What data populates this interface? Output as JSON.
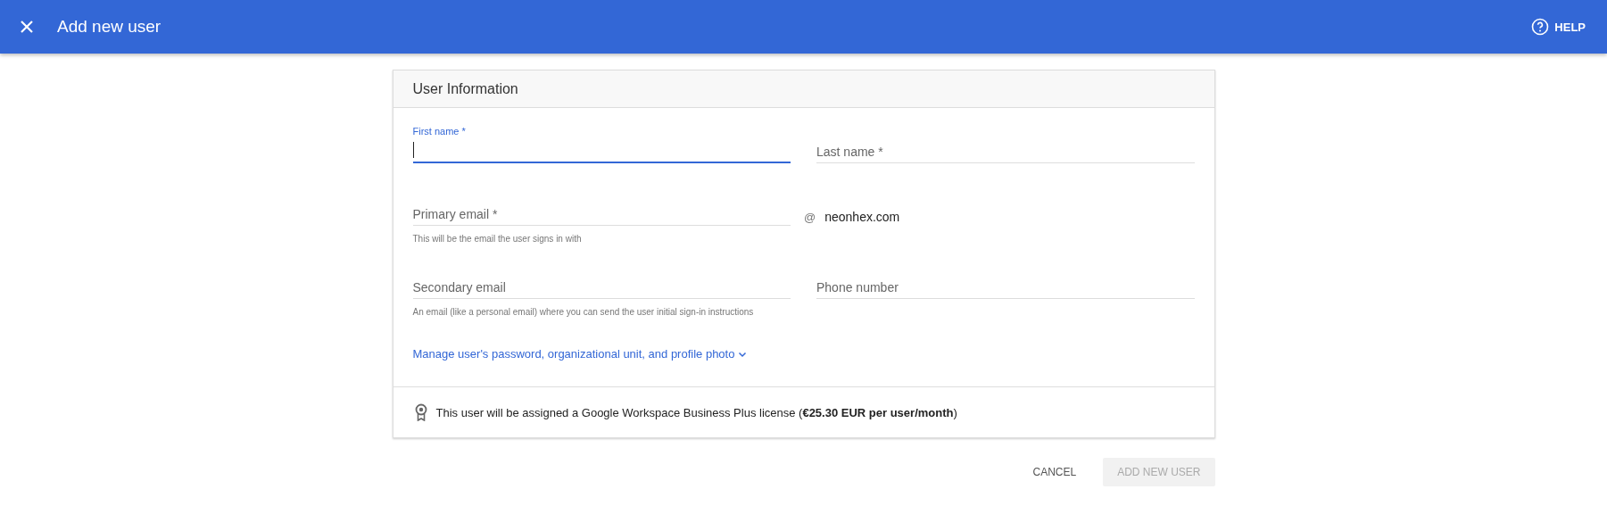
{
  "header": {
    "title": "Add new user",
    "help": "HELP"
  },
  "card": {
    "title": "User Information",
    "rows": [
      {
        "left": {
          "kind": "field",
          "label": "First name *",
          "focused": true
        },
        "right": {
          "kind": "field",
          "label": "Last name *",
          "focused": false
        }
      },
      {
        "left": {
          "kind": "field",
          "label": "Primary email *",
          "focused": false,
          "helper": "This will be the email the user signs in with"
        },
        "right": {
          "kind": "domain",
          "at": "@",
          "domain": "neonhex.com"
        }
      },
      {
        "left": {
          "kind": "field",
          "label": "Secondary email",
          "focused": false,
          "helper": "An email (like a personal email) where you can send the user initial sign-in instructions"
        },
        "right": {
          "kind": "field",
          "label": "Phone number",
          "focused": false
        }
      }
    ],
    "manage_link": "Manage user's password, organizational unit, and profile photo",
    "license": "This user will be assigned a Google Workspace Business Plus license (**€25.30 EUR per user/month**)"
  },
  "buttons": [
    {
      "label": "CANCEL",
      "disabled": false
    },
    {
      "label": "ADD NEW USER",
      "disabled": true
    }
  ]
}
